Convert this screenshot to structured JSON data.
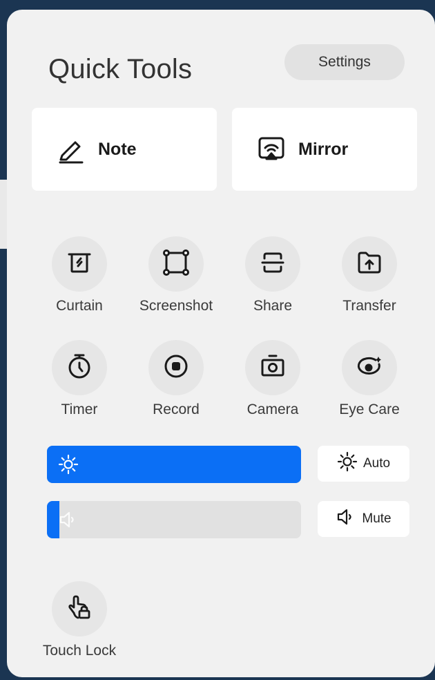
{
  "panel": {
    "title": "Quick Tools",
    "settings_label": "Settings"
  },
  "shortcuts": [
    {
      "label": "Note",
      "icon": "pen-icon"
    },
    {
      "label": "Mirror",
      "icon": "screen-mirror-icon"
    }
  ],
  "tools": [
    {
      "label": "Curtain",
      "icon": "curtain-icon"
    },
    {
      "label": "Screenshot",
      "icon": "screenshot-icon"
    },
    {
      "label": "Share",
      "icon": "share-scan-icon"
    },
    {
      "label": "Transfer",
      "icon": "folder-upload-icon"
    },
    {
      "label": "Timer",
      "icon": "timer-icon"
    },
    {
      "label": "Record",
      "icon": "record-icon"
    },
    {
      "label": "Camera",
      "icon": "camera-icon"
    },
    {
      "label": "Eye Care",
      "icon": "eye-care-icon"
    }
  ],
  "brightness": {
    "level": 1.0,
    "auto_label": "Auto",
    "icon": "sun-icon",
    "color": "#0b6ff5"
  },
  "volume": {
    "level": 0.05,
    "mute_label": "Mute",
    "icon": "speaker-icon"
  },
  "touch_lock": {
    "label": "Touch Lock",
    "icon": "hand-lock-icon"
  }
}
